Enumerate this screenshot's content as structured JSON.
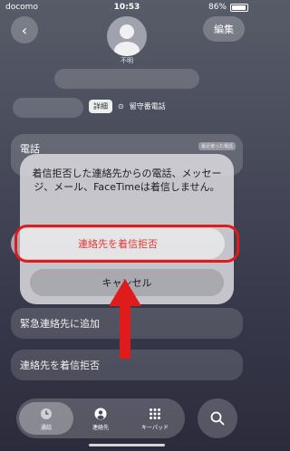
{
  "status": {
    "carrier": "docomo",
    "time": "10:53",
    "battery": "86%"
  },
  "header": {
    "edit_label": "編集",
    "contact_name": "不明"
  },
  "info_row": {
    "detail_tag": "詳細",
    "voicemail_label": "留守番電話"
  },
  "phone_section": {
    "label": "電話",
    "tag": "最近使った電話"
  },
  "dialog": {
    "message": "着信拒否した連絡先からの電話、メッセージ、メール、FaceTimeは着信しません。",
    "block_label": "連絡先を着信拒否",
    "cancel_label": "キャンセル"
  },
  "actions": [
    {
      "label": "緊急連絡先に追加"
    },
    {
      "label": "連絡先を着信拒否"
    }
  ],
  "tabbar": {
    "recents": "通話",
    "contacts": "連絡先",
    "keypad": "キーパッド"
  },
  "colors": {
    "destructive": "#e53935",
    "highlight": "#e01b1b"
  }
}
